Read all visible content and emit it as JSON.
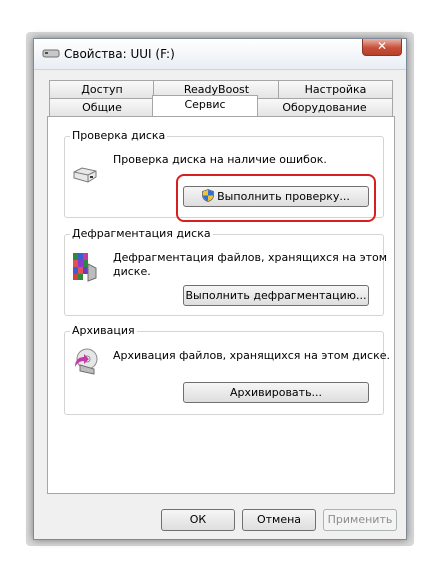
{
  "window": {
    "title": "Свойства: UUI (F:)",
    "close_label": "✕"
  },
  "tabs_top": [
    "Доступ",
    "ReadyBoost",
    "Настройка"
  ],
  "tabs_bottom": [
    "Общие",
    "Сервис",
    "Оборудование"
  ],
  "active_tab": "Сервис",
  "groups": {
    "check": {
      "title": "Проверка диска",
      "description": "Проверка диска на наличие ошибок.",
      "button": "Выполнить проверку..."
    },
    "defrag": {
      "title": "Дефрагментация диска",
      "description_line1": "Дефрагментация файлов, хранящихся на этом",
      "description_line2": "диске.",
      "button": "Выполнить дефрагментацию..."
    },
    "backup": {
      "title": "Архивация",
      "description": "Архивация файлов, хранящихся на этом диске.",
      "button": "Архивировать..."
    }
  },
  "footer": {
    "ok": "ОК",
    "cancel": "Отмена",
    "apply": "Применить"
  },
  "colors": {
    "highlight": "#d62020",
    "close_button": "#c7503a"
  }
}
